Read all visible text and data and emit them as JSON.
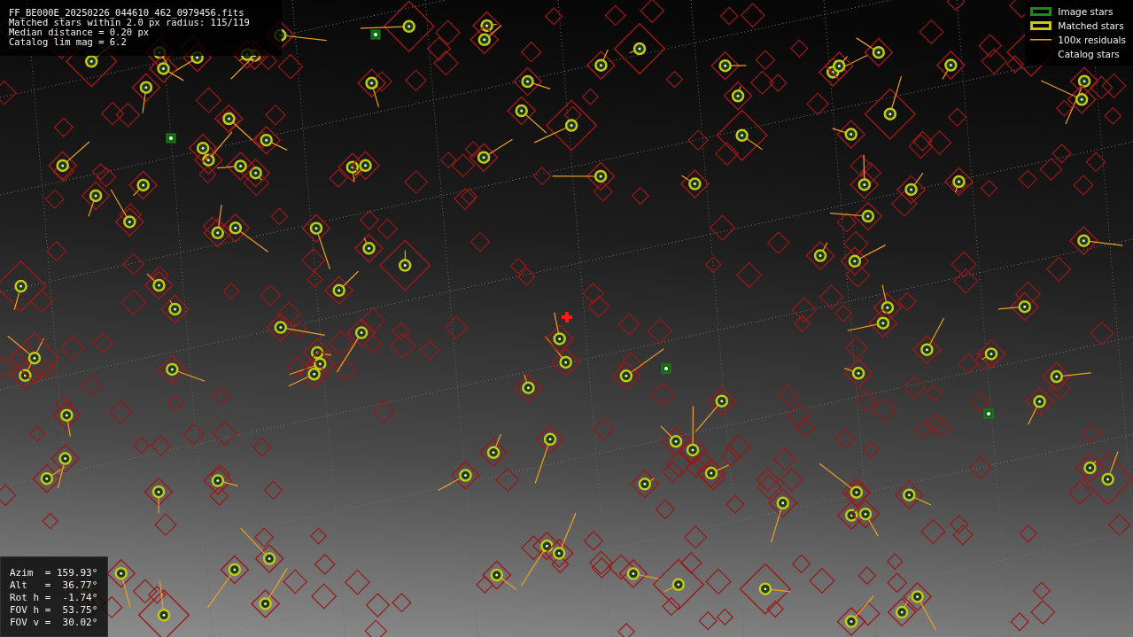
{
  "header": {
    "lines": [
      "FF_BE000E_20250226_044610_462_0979456.fits",
      "Matched stars within 2.0 px radius: 115/119",
      "Median distance = 0.20 px",
      "Catalog lim mag = 6.2"
    ]
  },
  "legend": [
    {
      "kind": "image",
      "label": "Image stars"
    },
    {
      "kind": "matched",
      "label": "Matched stars"
    },
    {
      "kind": "residual",
      "label": "100x residuals"
    },
    {
      "kind": "catalog",
      "label": "Catalog stars"
    }
  ],
  "pointing": {
    "lines": [
      "Azim  = 159.93°",
      "Alt   =  36.77°",
      "Rot h =  -1.74°",
      "FOV h =  53.75°",
      "FOV v =  30.02°"
    ]
  }
}
